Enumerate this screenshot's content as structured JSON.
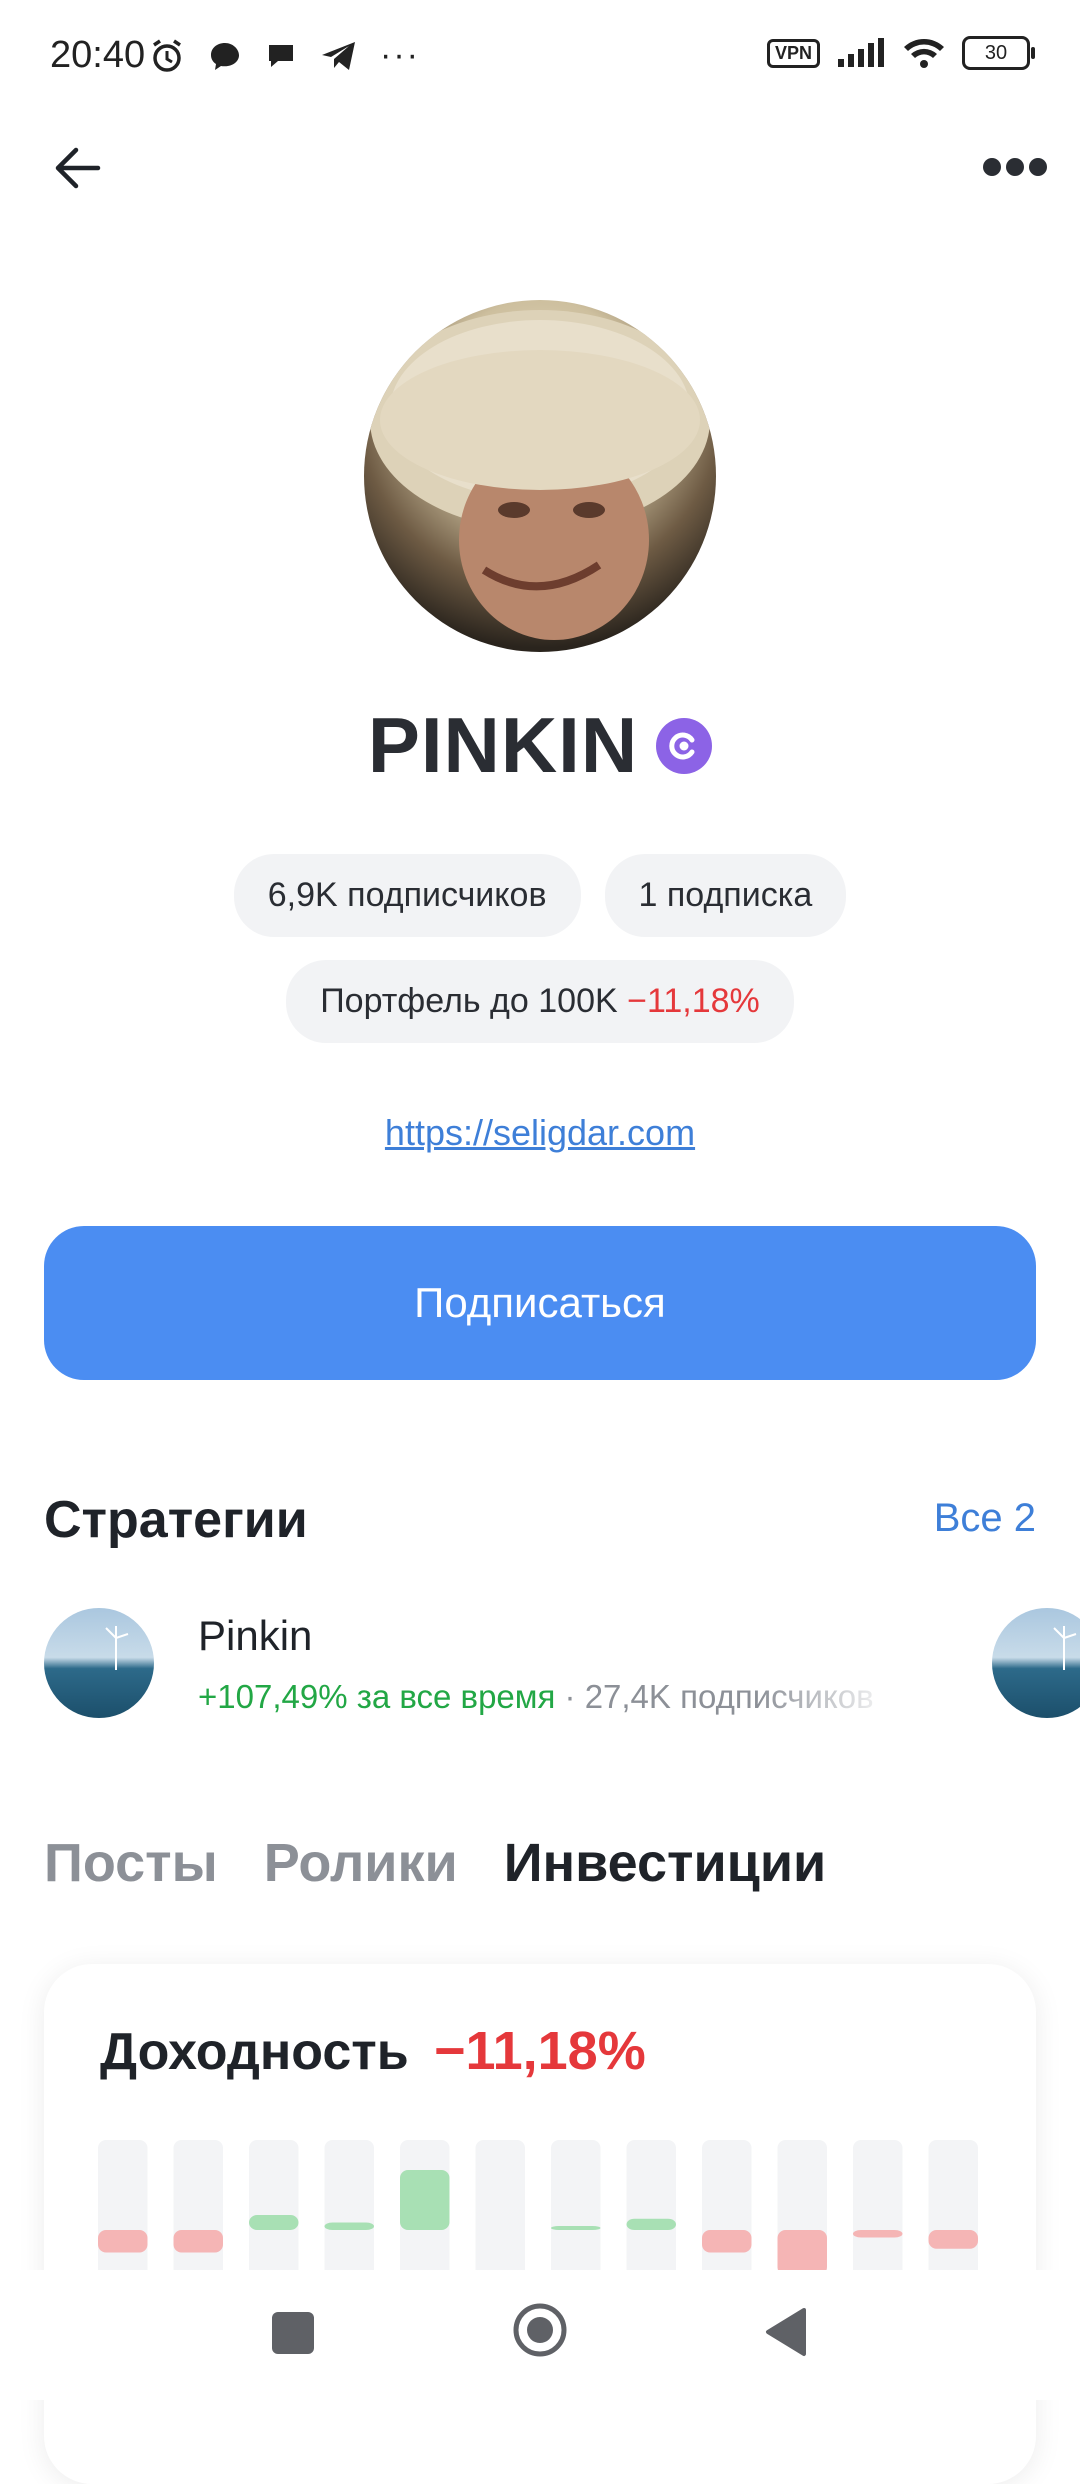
{
  "status_bar": {
    "time": "20:40",
    "vpn_label": "VPN",
    "battery": "30",
    "more_indicator": "···"
  },
  "profile": {
    "name": "PINKIN",
    "subscribers": "6,9K подписчиков",
    "subscriptions": "1 подписка",
    "portfolio_label": "Портфель до 100K",
    "portfolio_change": "−11,18%",
    "website": "https://seligdar.com",
    "subscribe_label": "Подписаться"
  },
  "strategies": {
    "title": "Стратегии",
    "all_label": "Все 2",
    "items": [
      {
        "name": "Pinkin",
        "return": "+107,49% за все время",
        "separator": " · ",
        "subscribers": "27,4K подписчиков"
      }
    ]
  },
  "tabs": [
    {
      "label": "Посты",
      "active": false
    },
    {
      "label": "Ролики",
      "active": false
    },
    {
      "label": "Инвестиции",
      "active": true
    }
  ],
  "returns_card": {
    "title": "Доходность",
    "value": "−11,18%",
    "monthly_returns_pct": [
      -3,
      -3,
      2,
      1,
      8,
      0,
      0.5,
      1.5,
      -3,
      -6,
      -1,
      -2.5
    ],
    "colors": {
      "positive": "#a8e0b4",
      "negative": "#f5b5b5",
      "track": "#f3f4f6"
    }
  },
  "colors": {
    "accent": "#4b8df2",
    "link": "#3e7fd8",
    "negative": "#e5383b",
    "positive": "#22a745",
    "verified_badge": "#8c63e6"
  }
}
